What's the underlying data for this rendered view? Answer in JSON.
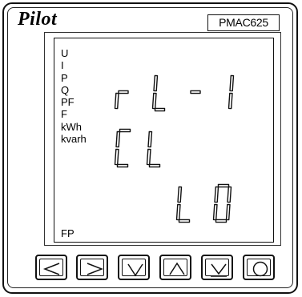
{
  "brand": "Pilot",
  "model": "PMAC625",
  "indicators": [
    "U",
    "I",
    "P",
    "Q",
    "PF",
    "F",
    "kWh",
    "kvarh"
  ],
  "bottom_indicator": "FP",
  "display": {
    "row1": "rL-1",
    "row2": "CL",
    "row3": "L0"
  },
  "buttons": [
    {
      "icon": "left-arrow-icon"
    },
    {
      "icon": "right-arrow-icon"
    },
    {
      "icon": "down-arrow-icon"
    },
    {
      "icon": "up-arrow-icon"
    },
    {
      "icon": "down-enter-icon"
    },
    {
      "icon": "circle-icon"
    }
  ]
}
